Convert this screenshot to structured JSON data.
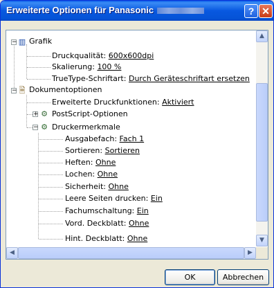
{
  "window": {
    "title": "Erweiterte Optionen für Panasonic",
    "help_label": "?",
    "close_label": "✕"
  },
  "tree": {
    "grafik": {
      "label": "Grafik",
      "items": [
        {
          "label": "Druckqualität:",
          "value": "600x600dpi"
        },
        {
          "label": "Skalierung:",
          "value": "100 %"
        },
        {
          "label": "TrueType-Schriftart:",
          "value": "Durch Geräteschriftart ersetzen"
        }
      ]
    },
    "dokumentoptionen": {
      "label": "Dokumentoptionen",
      "druckfunktionen": {
        "label": "Erweiterte Druckfunktionen:",
        "value": "Aktiviert"
      },
      "postscript": {
        "label": "PostScript-Optionen"
      },
      "druckermerkmale": {
        "label": "Druckermerkmale",
        "items": [
          {
            "label": "Ausgabefach:",
            "value": "Fach 1"
          },
          {
            "label": "Sortieren:",
            "value": "Sortieren"
          },
          {
            "label": "Heften:",
            "value": "Ohne"
          },
          {
            "label": "Lochen:",
            "value": "Ohne"
          },
          {
            "label": "Sicherheit:",
            "value": "Ohne"
          },
          {
            "label": "Leere Seiten drucken:",
            "value": "Ein"
          },
          {
            "label": "Fachumschaltung:",
            "value": "Ein"
          },
          {
            "label": "Vord. Deckblatt:",
            "value": "Ohne"
          },
          {
            "label": "Hint. Deckblatt:",
            "value": "Ohne"
          }
        ]
      }
    }
  },
  "buttons": {
    "ok": "OK",
    "cancel": "Abbrechen"
  },
  "icons": {
    "grafik": "chart-icon",
    "dokument": "document-options-icon",
    "postscript": "postscript-icon",
    "drucker": "printer-features-icon"
  },
  "colors": {
    "titlebar": "#0858e0",
    "accent": "#0831d9",
    "dialog_bg": "#ece9d8"
  }
}
